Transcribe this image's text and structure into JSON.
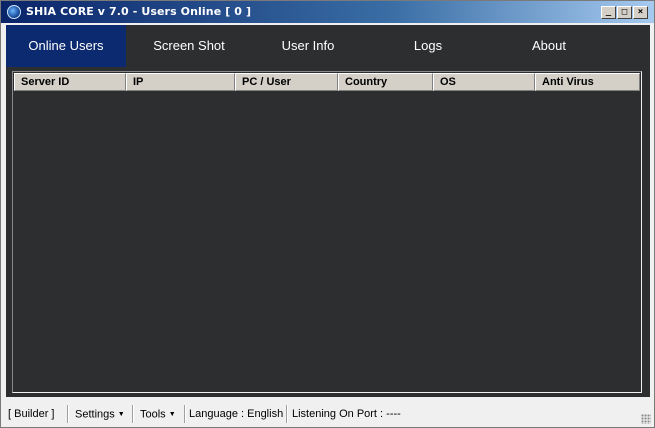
{
  "window": {
    "title": "SHIA CORE v 7.0 - Users Online [ 0 ]",
    "controls": {
      "minimize": "_",
      "maximize": "□",
      "close": "×"
    }
  },
  "tabs": [
    {
      "label": "Online Users",
      "active": true
    },
    {
      "label": "Screen Shot",
      "active": false
    },
    {
      "label": "User Info",
      "active": false
    },
    {
      "label": "Logs",
      "active": false
    },
    {
      "label": "About",
      "active": false
    }
  ],
  "table": {
    "columns": [
      "Server ID",
      "IP",
      "PC / User",
      "Country",
      "OS",
      "Anti Virus"
    ],
    "rows": []
  },
  "statusbar": {
    "builder": "[  Builder  ]",
    "settings": "Settings",
    "tools": "Tools",
    "language": "Language : English",
    "port": "Listening On Port : ----"
  },
  "colors": {
    "active_tab": "#0b2a70",
    "panel_bg": "#2d2e30",
    "titlebar": "#0a246a"
  }
}
